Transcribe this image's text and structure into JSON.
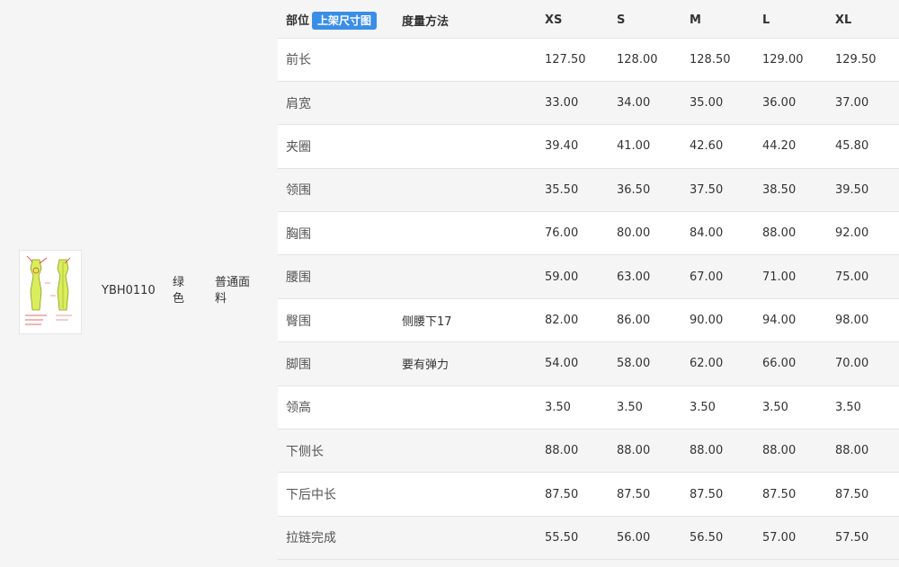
{
  "product": {
    "code": "YBH0110",
    "color": "绿色",
    "fabric": "普通面料"
  },
  "table": {
    "header": {
      "part": "部位",
      "tag": "上架尺寸图",
      "method": "度量方法",
      "sizes": [
        "XS",
        "S",
        "M",
        "L",
        "XL"
      ]
    },
    "rows": [
      {
        "part": "前长",
        "method": "",
        "values": [
          "127.50",
          "128.00",
          "128.50",
          "129.00",
          "129.50"
        ]
      },
      {
        "part": "肩宽",
        "method": "",
        "values": [
          "33.00",
          "34.00",
          "35.00",
          "36.00",
          "37.00"
        ]
      },
      {
        "part": "夹圈",
        "method": "",
        "values": [
          "39.40",
          "41.00",
          "42.60",
          "44.20",
          "45.80"
        ]
      },
      {
        "part": "领围",
        "method": "",
        "values": [
          "35.50",
          "36.50",
          "37.50",
          "38.50",
          "39.50"
        ]
      },
      {
        "part": "胸围",
        "method": "",
        "values": [
          "76.00",
          "80.00",
          "84.00",
          "88.00",
          "92.00"
        ]
      },
      {
        "part": "腰围",
        "method": "",
        "values": [
          "59.00",
          "63.00",
          "67.00",
          "71.00",
          "75.00"
        ]
      },
      {
        "part": "臀围",
        "method": "侧腰下17",
        "values": [
          "82.00",
          "86.00",
          "90.00",
          "94.00",
          "98.00"
        ]
      },
      {
        "part": "脚围",
        "method": "要有弹力",
        "values": [
          "54.00",
          "58.00",
          "62.00",
          "66.00",
          "70.00"
        ]
      },
      {
        "part": "领高",
        "method": "",
        "values": [
          "3.50",
          "3.50",
          "3.50",
          "3.50",
          "3.50"
        ]
      },
      {
        "part": "下侧长",
        "method": "",
        "values": [
          "88.00",
          "88.00",
          "88.00",
          "88.00",
          "88.00"
        ]
      },
      {
        "part": "下后中长",
        "method": "",
        "values": [
          "87.50",
          "87.50",
          "87.50",
          "87.50",
          "87.50"
        ]
      },
      {
        "part": "拉链完成",
        "method": "",
        "values": [
          "55.50",
          "56.00",
          "56.50",
          "57.00",
          "57.50"
        ]
      }
    ]
  }
}
